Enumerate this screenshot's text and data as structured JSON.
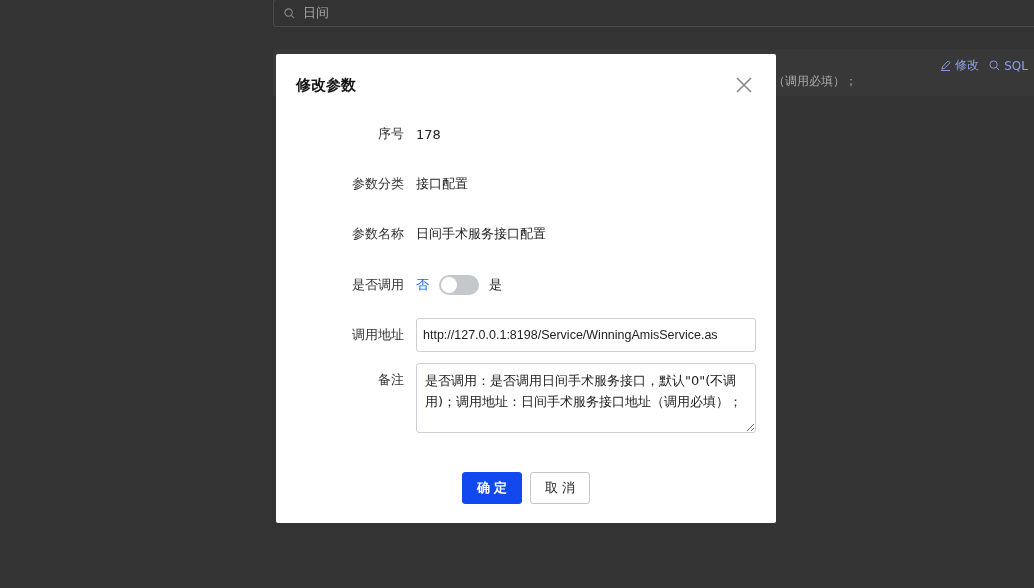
{
  "background": {
    "search": {
      "value": "日间"
    },
    "row": {
      "text": "（调用必填）；",
      "actions": [
        "修改",
        "SQL"
      ]
    }
  },
  "dialog": {
    "title": "修改参数",
    "fields": [
      {
        "kind": "text",
        "label": "序号",
        "value": "178"
      },
      {
        "kind": "text",
        "label": "参数分类",
        "value": "接口配置"
      },
      {
        "kind": "text",
        "label": "参数名称",
        "value": "日间手术服务接口配置"
      },
      {
        "kind": "switch",
        "label": "是否调用",
        "off_label": "否",
        "on_label": "是",
        "on": false
      },
      {
        "kind": "input",
        "label": "调用地址",
        "value": "http://127.0.0.1:8198/Service/WinningAmisService.as"
      },
      {
        "kind": "textarea",
        "label": "备注",
        "value": "是否调用：是否调用日间手术服务接口，默认\"0\"(不调用)；调用地址：日间手术服务接口地址（调用必填）；"
      }
    ],
    "buttons": [
      {
        "kind": "primary",
        "label": "确 定"
      },
      {
        "kind": "default",
        "label": "取 消"
      }
    ]
  }
}
